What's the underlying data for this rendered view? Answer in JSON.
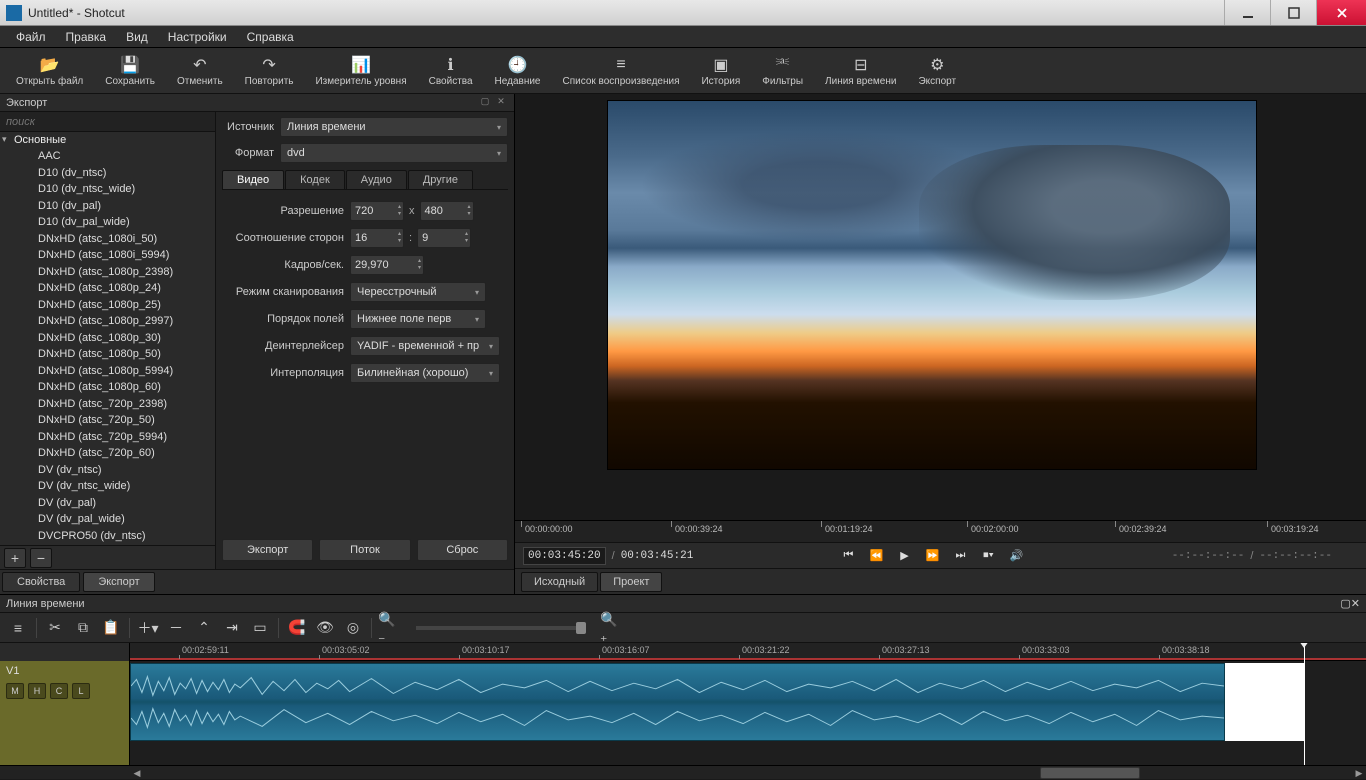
{
  "window": {
    "title": "Untitled* - Shotcut"
  },
  "menu": [
    "Файл",
    "Правка",
    "Вид",
    "Настройки",
    "Справка"
  ],
  "toolbar": [
    {
      "icon": "📂",
      "label": "Открыть файл",
      "name": "open-file-button"
    },
    {
      "icon": "💾",
      "label": "Сохранить",
      "name": "save-button"
    },
    {
      "icon": "↶",
      "label": "Отменить",
      "name": "undo-button"
    },
    {
      "icon": "↷",
      "label": "Повторить",
      "name": "redo-button"
    },
    {
      "icon": "📊",
      "label": "Измеритель уровня",
      "name": "peak-meter-button"
    },
    {
      "icon": "ℹ",
      "label": "Свойства",
      "name": "properties-button"
    },
    {
      "icon": "🕘",
      "label": "Недавние",
      "name": "recent-button"
    },
    {
      "icon": "≡",
      "label": "Список воспроизведения",
      "name": "playlist-button"
    },
    {
      "icon": "▣",
      "label": "История",
      "name": "history-button"
    },
    {
      "icon": "⎃",
      "label": "Фильтры",
      "name": "filters-button"
    },
    {
      "icon": "⊟",
      "label": "Линия времени",
      "name": "timeline-button"
    },
    {
      "icon": "⚙",
      "label": "Экспорт",
      "name": "export-button"
    }
  ],
  "export": {
    "title": "Экспорт",
    "search_placeholder": "поиск",
    "category": "Основные",
    "presets": [
      "AAC",
      "D10 (dv_ntsc)",
      "D10 (dv_ntsc_wide)",
      "D10 (dv_pal)",
      "D10 (dv_pal_wide)",
      "DNxHD (atsc_1080i_50)",
      "DNxHD (atsc_1080i_5994)",
      "DNxHD (atsc_1080p_2398)",
      "DNxHD (atsc_1080p_24)",
      "DNxHD (atsc_1080p_25)",
      "DNxHD (atsc_1080p_2997)",
      "DNxHD (atsc_1080p_30)",
      "DNxHD (atsc_1080p_50)",
      "DNxHD (atsc_1080p_5994)",
      "DNxHD (atsc_1080p_60)",
      "DNxHD (atsc_720p_2398)",
      "DNxHD (atsc_720p_50)",
      "DNxHD (atsc_720p_5994)",
      "DNxHD (atsc_720p_60)",
      "DV (dv_ntsc)",
      "DV (dv_ntsc_wide)",
      "DV (dv_pal)",
      "DV (dv_pal_wide)",
      "DVCPRO50 (dv_ntsc)"
    ],
    "source_label": "Источник",
    "source_value": "Линия времени",
    "format_label": "Формат",
    "format_value": "dvd",
    "tabs": [
      "Видео",
      "Кодек",
      "Аудио",
      "Другие"
    ],
    "fields": {
      "resolution": {
        "label": "Разрешение",
        "w": "720",
        "h": "480",
        "x": "x"
      },
      "aspect": {
        "label": "Соотношение сторон",
        "w": "16",
        "h": "9",
        "sep": ":"
      },
      "fps": {
        "label": "Кадров/сек.",
        "val": "29,970"
      },
      "scanmode": {
        "label": "Режим сканирования",
        "val": "Чересстрочный"
      },
      "fieldorder": {
        "label": "Порядок полей",
        "val": "Нижнее поле перв"
      },
      "deinterlacer": {
        "label": "Деинтерлейсер",
        "val": "YADIF - временной + пр"
      },
      "interpolation": {
        "label": "Интерполяция",
        "val": "Билинейная (хорошо)"
      }
    },
    "buttons": {
      "export": "Экспорт",
      "stream": "Поток",
      "reset": "Сброс"
    },
    "bottom_tabs": [
      "Свойства",
      "Экспорт"
    ]
  },
  "preview": {
    "ruler_ticks": [
      {
        "pos": 10,
        "label": "00:00:00:00"
      },
      {
        "pos": 160,
        "label": "00:00:39:24"
      },
      {
        "pos": 310,
        "label": "00:01:19:24"
      },
      {
        "pos": 456,
        "label": "00:02:00:00"
      },
      {
        "pos": 604,
        "label": "00:02:39:24"
      },
      {
        "pos": 756,
        "label": "00:03:19:24"
      }
    ],
    "current_tc": "00:03:45:20",
    "total_tc": "00:03:45:21",
    "dashes_in": "--:--:--:--",
    "dashes_out": "--:--:--:--",
    "tabs": [
      "Исходный",
      "Проект"
    ]
  },
  "timeline": {
    "title": "Линия времени",
    "track_name": "V1",
    "track_buttons": [
      "M",
      "H",
      "C",
      "L"
    ],
    "ruler_ticks": [
      {
        "pos": 52,
        "label": "00:02:59:11"
      },
      {
        "pos": 192,
        "label": "00:03:05:02"
      },
      {
        "pos": 332,
        "label": "00:03:10:17"
      },
      {
        "pos": 472,
        "label": "00:03:16:07"
      },
      {
        "pos": 612,
        "label": "00:03:21:22"
      },
      {
        "pos": 752,
        "label": "00:03:27:13"
      },
      {
        "pos": 892,
        "label": "00:03:33:03"
      },
      {
        "pos": 1032,
        "label": "00:03:38:18"
      }
    ]
  }
}
